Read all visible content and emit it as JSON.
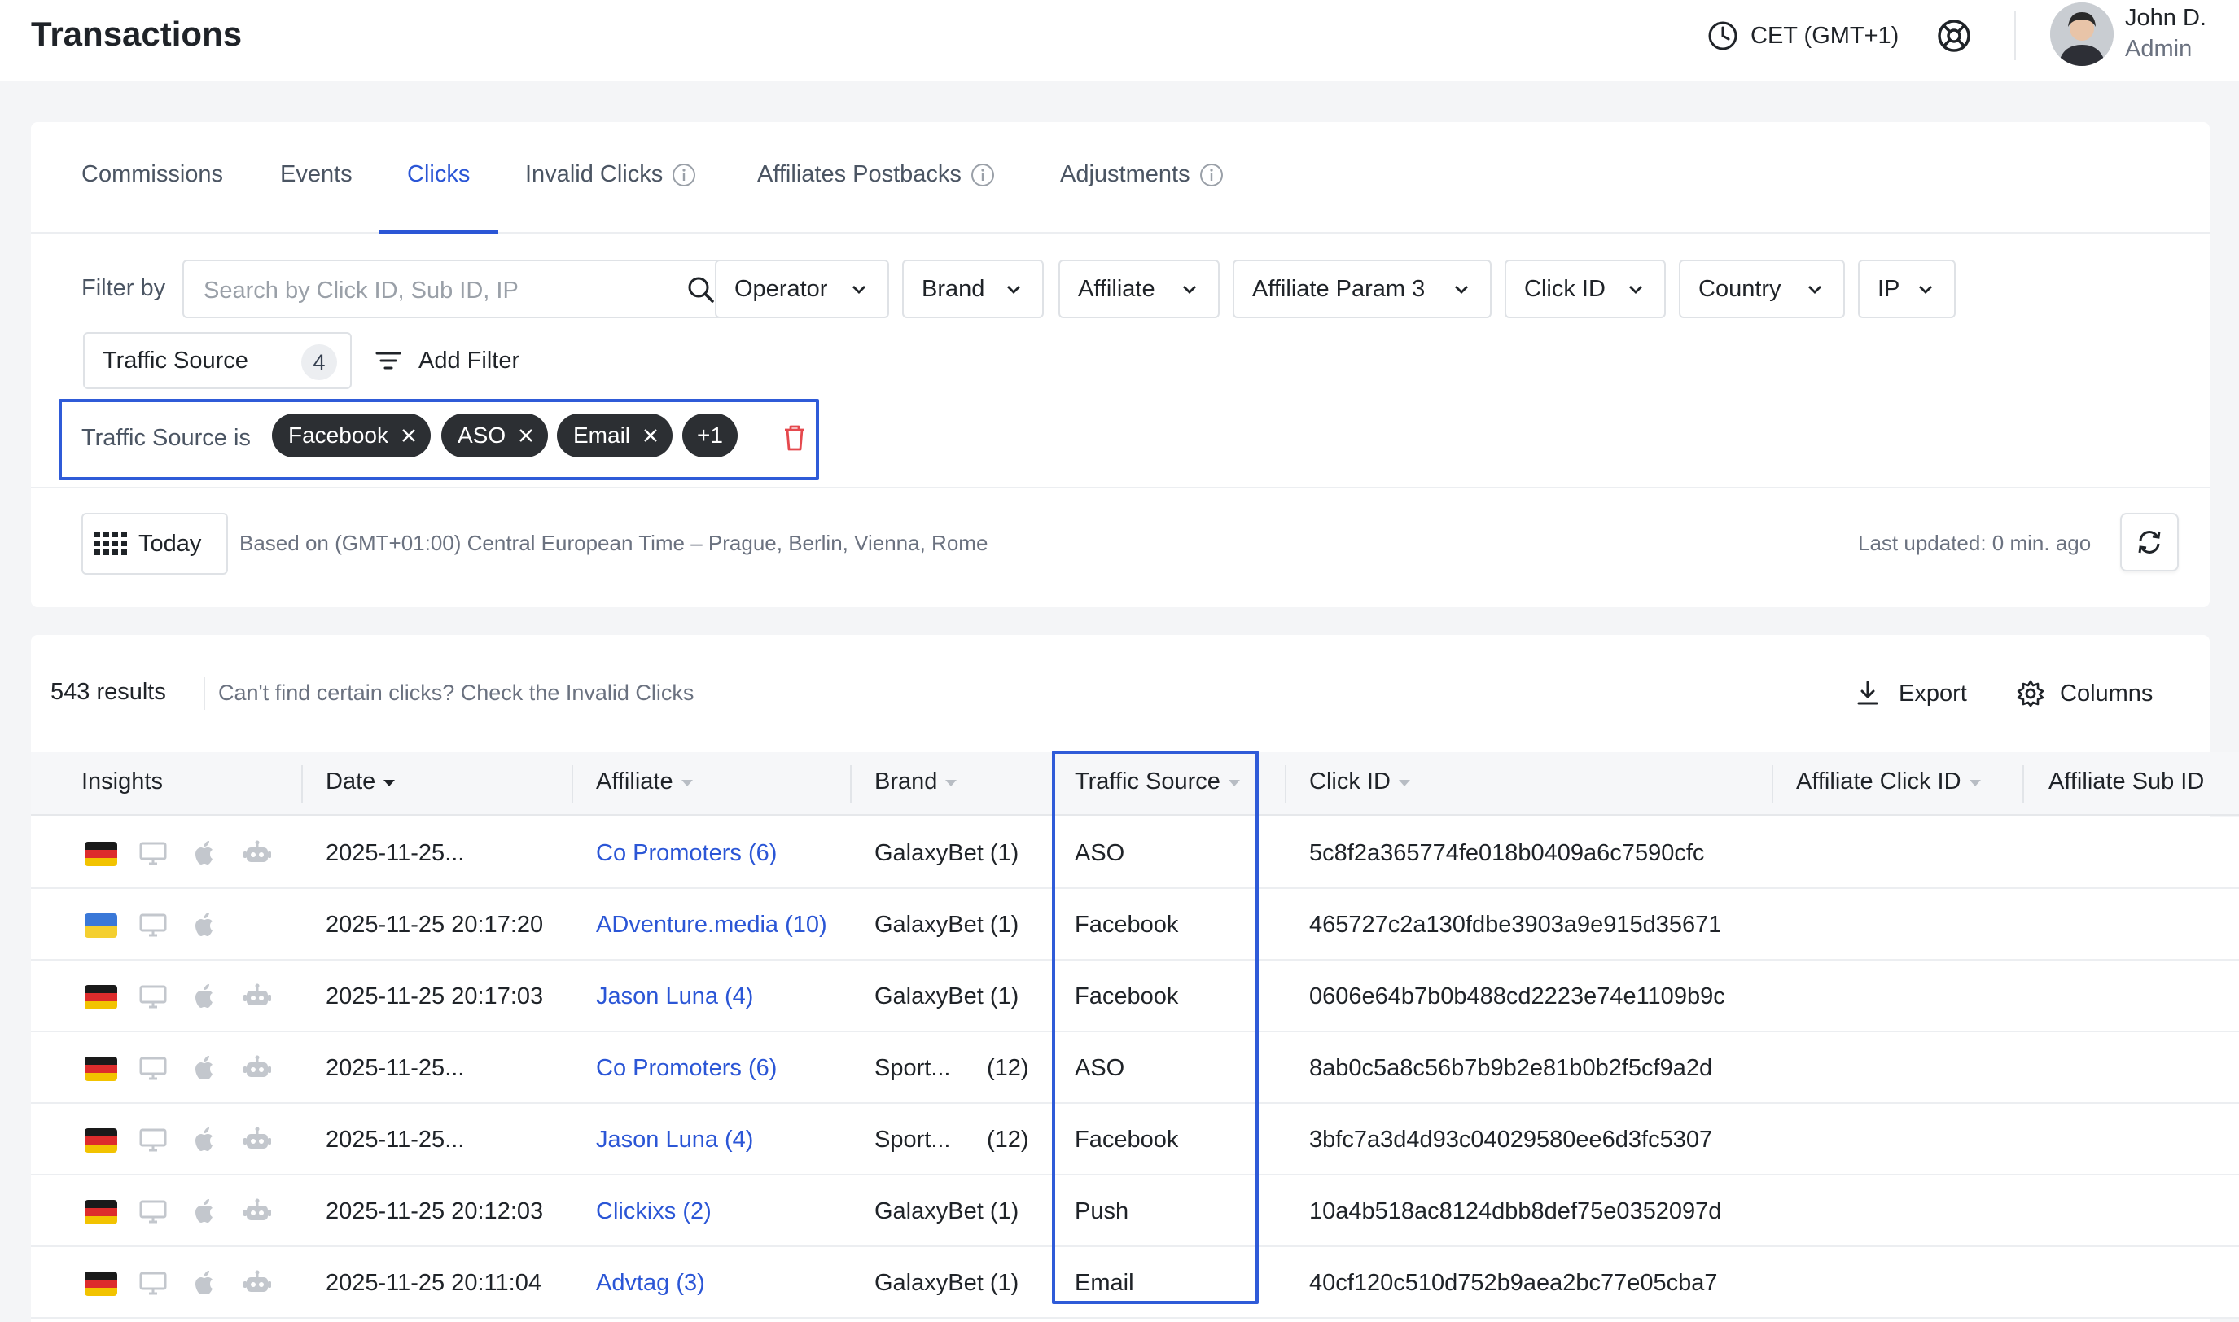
{
  "header": {
    "title": "Transactions",
    "timezone": "CET (GMT+1)",
    "user_name": "John D.",
    "user_role": "Admin"
  },
  "tabs": [
    {
      "label": "Commissions",
      "info": false
    },
    {
      "label": "Events",
      "info": false
    },
    {
      "label": "Clicks",
      "info": false,
      "active": true
    },
    {
      "label": "Invalid Clicks",
      "info": true
    },
    {
      "label": "Affiliates Postbacks",
      "info": true
    },
    {
      "label": "Adjustments",
      "info": true
    }
  ],
  "filters": {
    "filter_by_label": "Filter by",
    "search_placeholder": "Search by Click ID, Sub ID, IP",
    "dropdowns": [
      "Operator",
      "Brand",
      "Affiliate",
      "Affiliate Param 3",
      "Click ID",
      "Country",
      "IP"
    ],
    "traffic_source_label": "Traffic Source",
    "traffic_source_count": "4",
    "add_filter_label": "Add Filter",
    "active_filter_label": "Traffic Source is",
    "chips": [
      "Facebook",
      "ASO",
      "Email"
    ],
    "more_chip": "+1"
  },
  "date_bar": {
    "range_label": "Today",
    "timezone_note": "Based on (GMT+01:00) Central European Time – Prague, Berlin, Vienna, Rome",
    "last_updated": "Last updated: 0 min. ago"
  },
  "results": {
    "count_text": "543  results",
    "hint": "Can't find certain clicks? Check the Invalid Clicks",
    "export_label": "Export",
    "columns_label": "Columns"
  },
  "table": {
    "headers": [
      "Insights",
      "Date",
      "Affiliate",
      "Brand",
      "Traffic Source",
      "Click ID",
      "Affiliate Click ID",
      "Affiliate Sub ID"
    ],
    "rows": [
      {
        "flag": "de",
        "robot": true,
        "date": "2025-11-25...",
        "affiliate": "Co Promoters (6)",
        "brand": "GalaxyBet (1)",
        "brand_count": "",
        "source": "ASO",
        "click_id": "5c8f2a365774fe018b0409a6c7590cfc"
      },
      {
        "flag": "ua",
        "robot": false,
        "date": "2025-11-25 20:17:20",
        "affiliate": "ADventure.media (10)",
        "brand": "GalaxyBet (1)",
        "brand_count": "",
        "source": "Facebook",
        "click_id": "465727c2a130fdbe3903a9e915d35671"
      },
      {
        "flag": "de",
        "robot": true,
        "date": "2025-11-25 20:17:03",
        "affiliate": "Jason Luna (4)",
        "brand": "GalaxyBet (1)",
        "brand_count": "",
        "source": "Facebook",
        "click_id": "0606e64b7b0b488cd2223e74e1109b9c"
      },
      {
        "flag": "de",
        "robot": true,
        "date": "2025-11-25...",
        "affiliate": "Co Promoters (6)",
        "brand": "Sport...",
        "brand_count": "(12)",
        "source": "ASO",
        "click_id": "8ab0c5a8c56b7b9b2e81b0b2f5cf9a2d"
      },
      {
        "flag": "de",
        "robot": true,
        "date": "2025-11-25...",
        "affiliate": "Jason Luna (4)",
        "brand": "Sport...",
        "brand_count": "(12)",
        "source": "Facebook",
        "click_id": "3bfc7a3d4d93c04029580ee6d3fc5307"
      },
      {
        "flag": "de",
        "robot": true,
        "date": "2025-11-25 20:12:03",
        "affiliate": "Clickixs (2)",
        "brand": "GalaxyBet (1)",
        "brand_count": "",
        "source": "Push",
        "click_id": "10a4b518ac8124dbb8def75e0352097d"
      },
      {
        "flag": "de",
        "robot": true,
        "date": "2025-11-25 20:11:04",
        "affiliate": "Advtag (3)",
        "brand": "GalaxyBet (1)",
        "brand_count": "",
        "source": "Email",
        "click_id": "40cf120c510d752b9aea2bc77e05cba7"
      }
    ]
  },
  "colors": {
    "accent": "#2b56d6",
    "highlight_box": "#2f5bd8",
    "chip_bg": "#2c2f33",
    "trash": "#e5484d"
  }
}
